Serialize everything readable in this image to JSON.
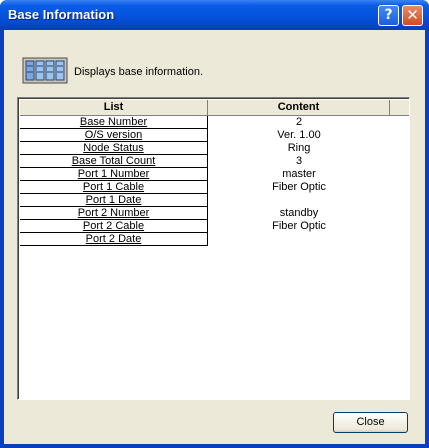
{
  "window": {
    "title": "Base Information",
    "help_glyph": "?",
    "close_glyph": "✕"
  },
  "header": {
    "icon": "base-rack-icon",
    "description": "Displays base information."
  },
  "table": {
    "columns": [
      "List",
      "Content"
    ],
    "rows": [
      {
        "label": "Base Number",
        "value": "2"
      },
      {
        "label": "O/S version",
        "value": "Ver. 1.00"
      },
      {
        "label": "Node Status",
        "value": "Ring"
      },
      {
        "label": "Base Total Count",
        "value": "3"
      },
      {
        "label": "Port 1 Number",
        "value": "master"
      },
      {
        "label": "Port 1 Cable",
        "value": "Fiber Optic"
      },
      {
        "label": "Port 1 Date",
        "value": ""
      },
      {
        "label": "Port 2 Number",
        "value": "standby"
      },
      {
        "label": "Port 2 Cable",
        "value": "Fiber Optic"
      },
      {
        "label": "Port 2 Date",
        "value": ""
      }
    ]
  },
  "buttons": {
    "close_label": "Close"
  },
  "colors": {
    "titlebar": "#0553dc",
    "dialog_bg": "#ece9d8",
    "close_red": "#d34a22"
  }
}
